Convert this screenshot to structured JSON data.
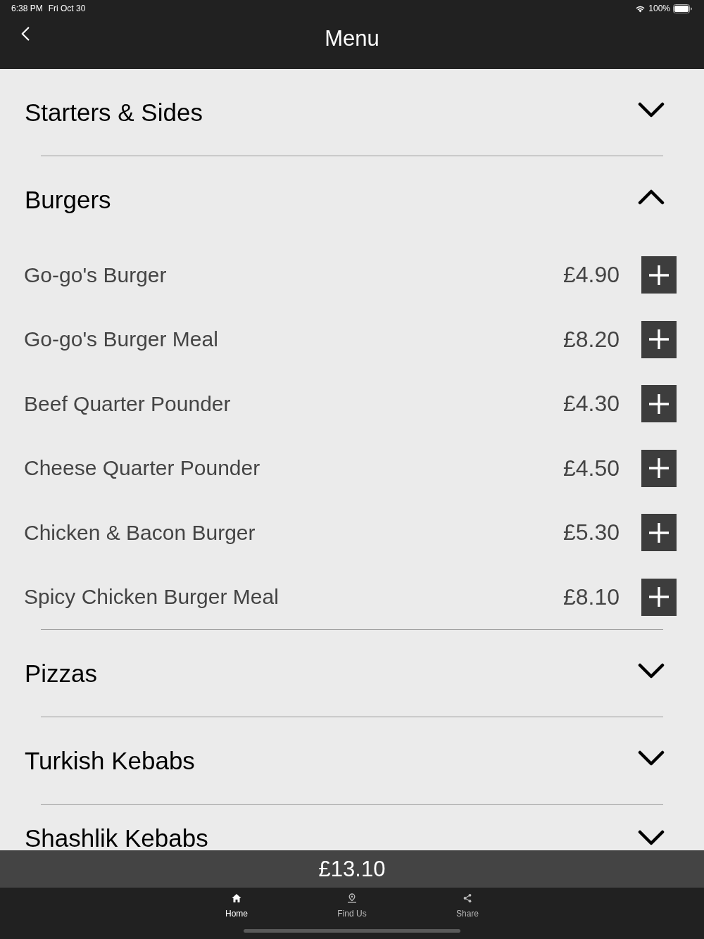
{
  "status_bar": {
    "time": "6:38 PM",
    "date": "Fri Oct 30",
    "battery": "100%"
  },
  "nav_bar": {
    "title": "Menu"
  },
  "categories": [
    {
      "name": "Starters & Sides",
      "expanded": false
    },
    {
      "name": "Burgers",
      "expanded": true,
      "items": [
        {
          "name": "Go-go's Burger",
          "price": "£4.90"
        },
        {
          "name": "Go-go's Burger Meal",
          "price": "£8.20"
        },
        {
          "name": "Beef Quarter Pounder",
          "price": "£4.30"
        },
        {
          "name": "Cheese Quarter Pounder",
          "price": "£4.50"
        },
        {
          "name": "Chicken & Bacon Burger",
          "price": "£5.30"
        },
        {
          "name": "Spicy Chicken Burger Meal",
          "price": "£8.10"
        }
      ]
    },
    {
      "name": "Pizzas",
      "expanded": false
    },
    {
      "name": "Turkish Kebabs",
      "expanded": false
    },
    {
      "name": "Shashlik Kebabs",
      "expanded": false
    }
  ],
  "basket": {
    "total": "£13.10"
  },
  "tab_bar": [
    {
      "label": "Home",
      "kind": "home",
      "selected": true
    },
    {
      "label": "Find Us",
      "kind": "location",
      "selected": false
    },
    {
      "label": "Share",
      "kind": "share",
      "selected": false
    }
  ]
}
